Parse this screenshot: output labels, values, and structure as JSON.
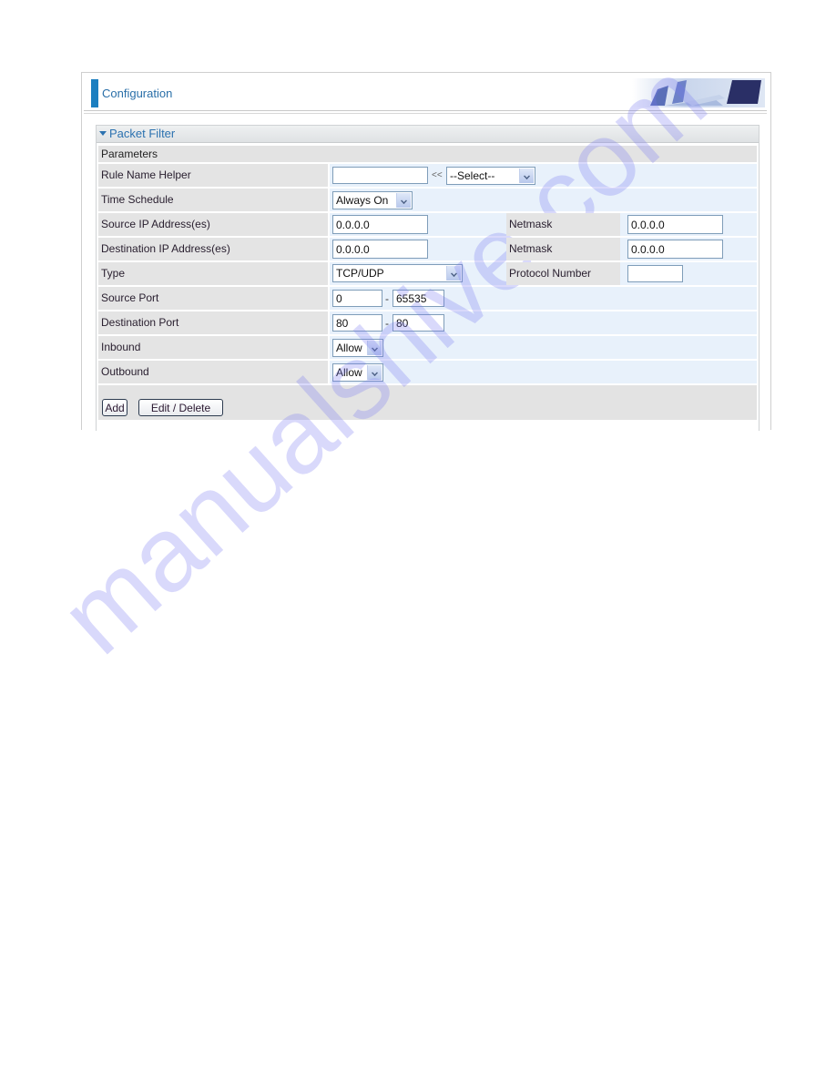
{
  "header": {
    "title": "Configuration",
    "accent_color": "#1c7fc0",
    "banner_icon": "office-chairs-monitor-banner"
  },
  "panel": {
    "title": "Packet Filter",
    "collapse_icon": "triangle-down-icon",
    "section_title": "Parameters"
  },
  "form": {
    "rule_name": {
      "label": "Rule Name  Helper",
      "value": "",
      "helper_arrow": "<<",
      "helper_select": "--Select--"
    },
    "time_schedule": {
      "label": "Time Schedule",
      "value": "Always On"
    },
    "source_ip": {
      "label": "Source IP Address(es)",
      "value": "0.0.0.0",
      "netmask_label": "Netmask",
      "netmask": "0.0.0.0"
    },
    "destination_ip": {
      "label": "Destination IP Address(es)",
      "value": "0.0.0.0",
      "netmask_label": "Netmask",
      "netmask": "0.0.0.0"
    },
    "type": {
      "label": "Type",
      "value": "TCP/UDP",
      "protocol_label": "Protocol Number",
      "protocol_number": ""
    },
    "source_port": {
      "label": "Source Port",
      "from": "0",
      "separator": "-",
      "to": "65535"
    },
    "destination_port": {
      "label": "Destination Port",
      "from": "80",
      "separator": "-",
      "to": "80"
    },
    "inbound": {
      "label": "Inbound",
      "value": "Allow"
    },
    "outbound": {
      "label": "Outbound",
      "value": "Allow"
    }
  },
  "buttons": {
    "add": "Add",
    "edit_delete": "Edit / Delete"
  },
  "watermark": "manualshive.com"
}
